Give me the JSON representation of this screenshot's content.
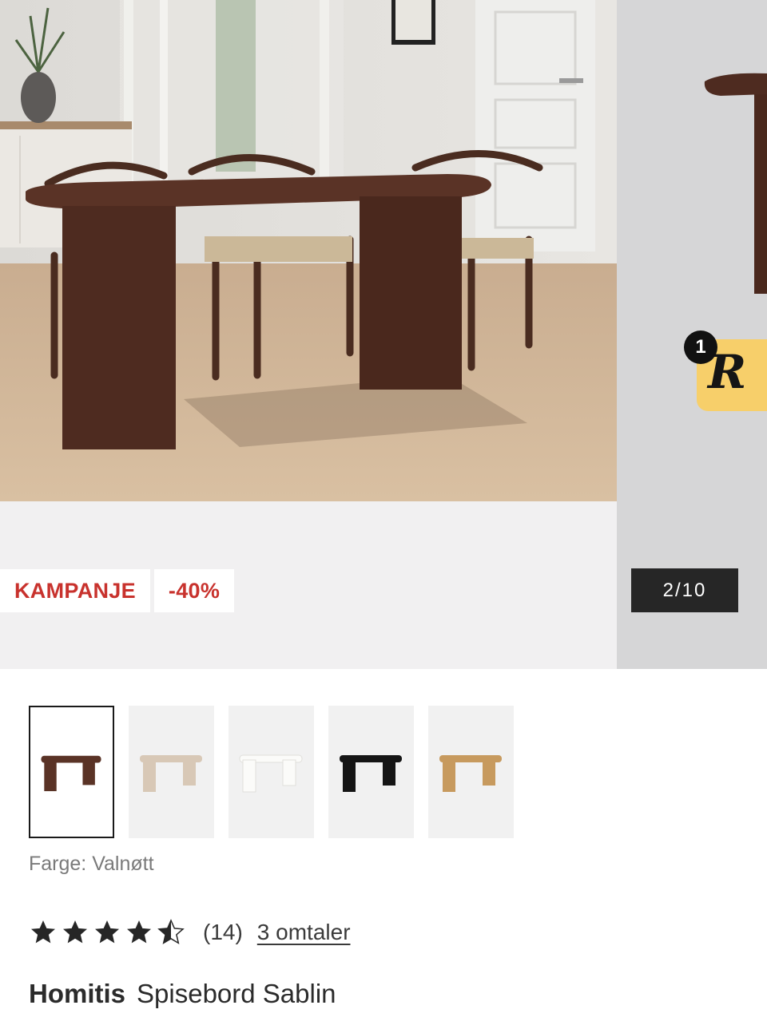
{
  "gallery": {
    "badges": [
      "KAMPANJE",
      "-40%"
    ],
    "counter": "2/10",
    "assistant_badge": {
      "count": "1",
      "letter": "R"
    }
  },
  "swatches": [
    {
      "name": "Valnøtt",
      "selected": true,
      "color": "#5a3326"
    },
    {
      "name": "Natur",
      "selected": false,
      "color": "#d8c8b6"
    },
    {
      "name": "Hvit",
      "selected": false,
      "color": "#eeede9"
    },
    {
      "name": "Svart",
      "selected": false,
      "color": "#151515"
    },
    {
      "name": "Eik",
      "selected": false,
      "color": "#c79a5e"
    }
  ],
  "color_label": "Farge: Valnøtt",
  "rating": {
    "value": 4.5,
    "max": 5,
    "count_text": "(14)",
    "reviews_link": "3 omtaler"
  },
  "product": {
    "brand": "Homitis",
    "name": "Spisebord Sablin"
  },
  "colors": {
    "accent_red": "#c8322d",
    "badge_yellow": "#f7cf6a",
    "counter_bg": "#262626"
  }
}
